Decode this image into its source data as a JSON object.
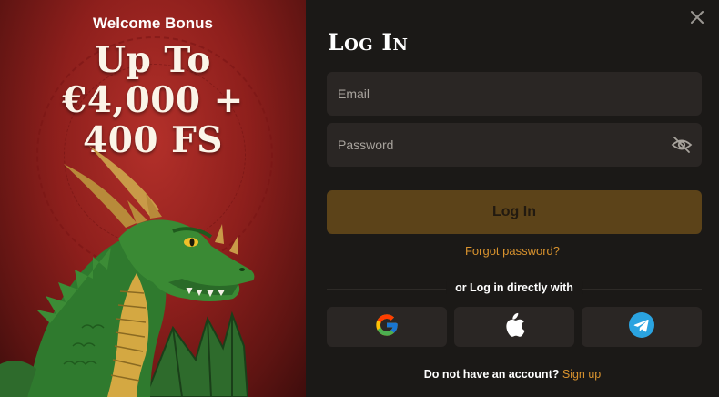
{
  "promo": {
    "eyebrow": "Welcome Bonus",
    "headline_lines": [
      "Up To",
      "€4,000 +",
      "400 FS"
    ]
  },
  "form": {
    "title": "Log In",
    "email_placeholder": "Email",
    "password_placeholder": "Password",
    "submit_label": "Log In",
    "forgot_label": "Forgot password?",
    "social_divider": "or Log in directly with",
    "social_providers": [
      {
        "name": "Google",
        "icon": "google-icon"
      },
      {
        "name": "Apple",
        "icon": "apple-icon"
      },
      {
        "name": "Telegram",
        "icon": "telegram-icon"
      }
    ],
    "signup_prompt": "Do not have an account?",
    "signup_link": "Sign up"
  },
  "colors": {
    "accent": "#d8922e",
    "button": "#5c4319",
    "panel": "#1b1917",
    "field": "#2a2624",
    "promo_red": "#8e1f1c"
  },
  "icons": {
    "close": "close-icon",
    "password_toggle": "eye-off-icon"
  }
}
